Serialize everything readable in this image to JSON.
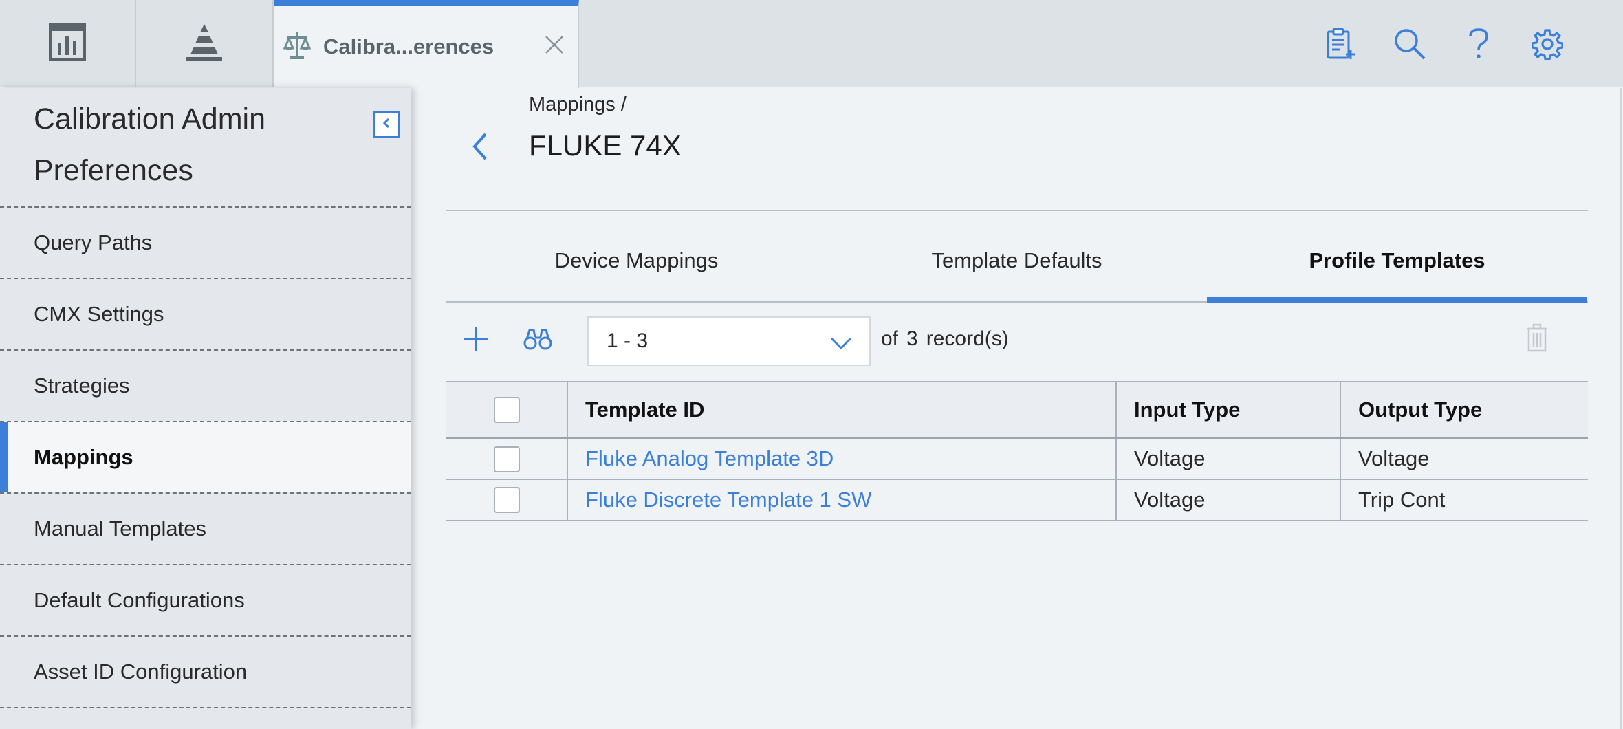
{
  "topbar": {
    "home_tabs": [
      {
        "icon": "dashboard-icon"
      },
      {
        "icon": "hierarchy-pyramid-icon"
      }
    ],
    "active_tab": {
      "icon": "calibration-scale-icon",
      "label": "Calibra...erences",
      "close_icon": "close-icon"
    },
    "actions": [
      {
        "icon": "clipboard-add-icon"
      },
      {
        "icon": "search-icon"
      },
      {
        "icon": "help-icon"
      },
      {
        "icon": "gear-icon"
      }
    ]
  },
  "sidebar": {
    "title_line1": "Calibration Admin",
    "title_line2": "Preferences",
    "items": [
      {
        "label": "Query Paths",
        "active": false
      },
      {
        "label": "CMX Settings",
        "active": false
      },
      {
        "label": "Strategies",
        "active": false
      },
      {
        "label": "Mappings",
        "active": true
      },
      {
        "label": "Manual Templates",
        "active": false
      },
      {
        "label": "Default Configurations",
        "active": false
      },
      {
        "label": "Asset ID Configuration",
        "active": false
      }
    ]
  },
  "main": {
    "breadcrumb": "Mappings /",
    "title": "FLUKE 74X",
    "tabs": [
      {
        "label": "Device Mappings",
        "active": false
      },
      {
        "label": "Template Defaults",
        "active": false
      },
      {
        "label": "Profile Templates",
        "active": true
      }
    ],
    "toolbar": {
      "range": "1 - 3",
      "of_label": "of",
      "total": "3",
      "records_label": "record(s)"
    },
    "table": {
      "columns": [
        "Template ID",
        "Input Type",
        "Output Type"
      ],
      "rows": [
        {
          "template_id": "Fluke Analog Template 3D",
          "input_type": "Voltage",
          "output_type": "Voltage"
        },
        {
          "template_id": "Fluke Discrete Template 1 SW",
          "input_type": "Voltage",
          "output_type": "Trip Cont"
        }
      ]
    }
  },
  "colors": {
    "accent": "#3b7fd8",
    "topbar_bg": "#dde2e7",
    "sidebar_bg": "#e4e8ec",
    "content_bg": "#eff3f6"
  }
}
